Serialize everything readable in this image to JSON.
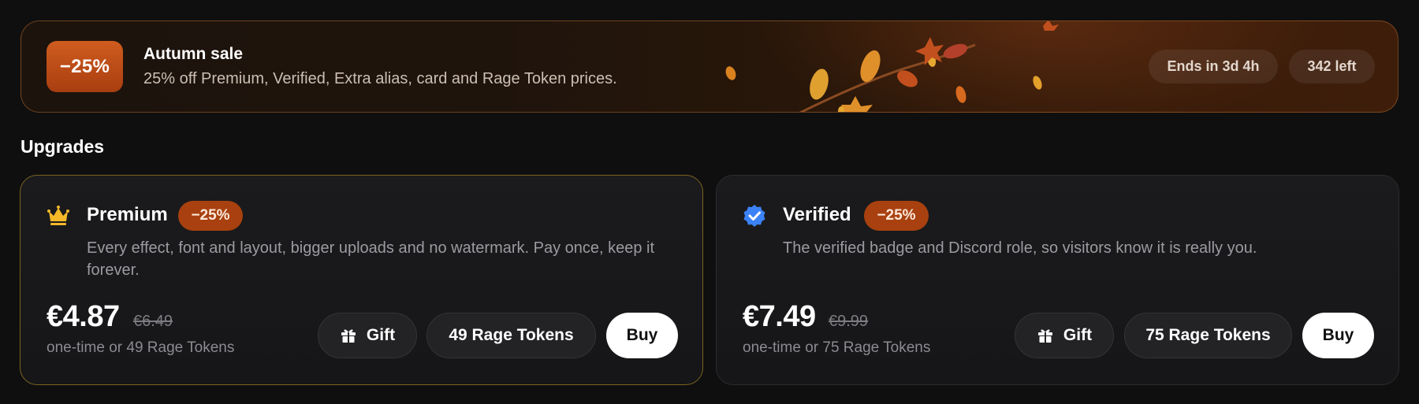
{
  "banner": {
    "discount": "−25%",
    "title": "Autumn sale",
    "subtitle": "25% off Premium, Verified, Extra alias, card and Rage Token prices.",
    "ends": "Ends in 3d 4h",
    "left": "342 left"
  },
  "section": {
    "title": "Upgrades"
  },
  "premium": {
    "icon": "crown-icon",
    "title": "Premium",
    "badge": "−25%",
    "description": "Every effect, font and layout, bigger uploads and no watermark. Pay once, keep it forever.",
    "price": "€4.87",
    "old_price": "€6.49",
    "note": "one-time or 49 Rage Tokens",
    "gift_label": "Gift",
    "tokens_label": "49 Rage Tokens",
    "buy_label": "Buy"
  },
  "verified": {
    "icon": "verified-check-icon",
    "title": "Verified",
    "badge": "−25%",
    "description": "The verified badge and Discord role, so visitors know it is really you.",
    "price": "€7.49",
    "old_price": "€9.99",
    "note": "one-time or 75 Rage Tokens",
    "gift_label": "Gift",
    "tokens_label": "75 Rage Tokens",
    "buy_label": "Buy"
  },
  "colors": {
    "accent_orange": "#a8410f",
    "premium_border": "#7a6320",
    "crown": "#f5b829",
    "verified_blue": "#3b82f6"
  }
}
